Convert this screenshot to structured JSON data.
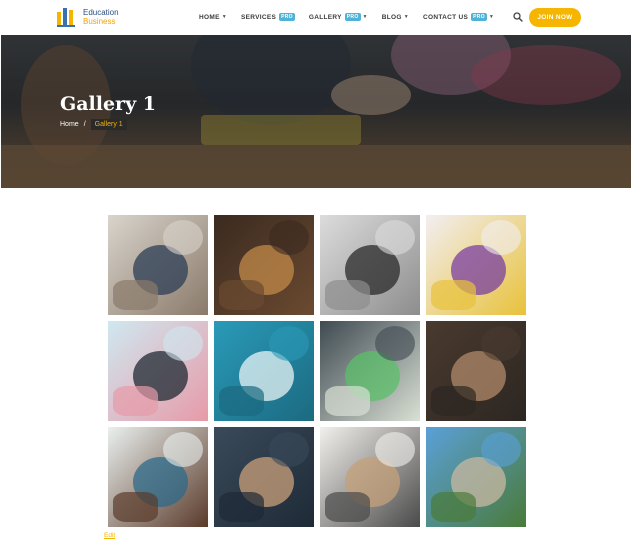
{
  "header": {
    "logo_line1": "Education",
    "logo_line2": "Business",
    "nav": [
      {
        "label": "HOME",
        "pro": false,
        "caret": true
      },
      {
        "label": "SERVICES",
        "pro": true,
        "caret": false
      },
      {
        "label": "GALLERY",
        "pro": true,
        "caret": true
      },
      {
        "label": "BLOG",
        "pro": false,
        "caret": true
      },
      {
        "label": "CONTACT US",
        "pro": true,
        "caret": true
      }
    ],
    "pro_badge": "PRO",
    "join_label": "JOIN NOW"
  },
  "hero": {
    "title": "Gallery 1",
    "breadcrumb_home": "Home",
    "breadcrumb_sep": "/",
    "breadcrumb_current": "Gallery 1"
  },
  "gallery": {
    "tiles": [
      {
        "subject": "students-writing",
        "colors": [
          "#d9d4cc",
          "#2c3e55",
          "#8a7a6a"
        ]
      },
      {
        "subject": "library-hall",
        "colors": [
          "#3a2a20",
          "#c28a4a",
          "#6b4a30"
        ]
      },
      {
        "subject": "classroom-screen",
        "colors": [
          "#dcdcdc",
          "#2a2a2a",
          "#8d8d8d"
        ]
      },
      {
        "subject": "colored-pencils",
        "colors": [
          "#f2eef2",
          "#7b3fa0",
          "#e8c23a"
        ]
      },
      {
        "subject": "pencil-cup",
        "colors": [
          "#cfe8f0",
          "#1f2a33",
          "#e79aa8"
        ]
      },
      {
        "subject": "palm-leaf",
        "colors": [
          "#2a9ab8",
          "#e8f4f6",
          "#1b6a80"
        ]
      },
      {
        "subject": "paint-palette",
        "colors": [
          "#3f4a52",
          "#5bbf6a",
          "#d9e0d4"
        ]
      },
      {
        "subject": "student-glasses",
        "colors": [
          "#4a3a2e",
          "#b08a6a",
          "#2c2622"
        ]
      },
      {
        "subject": "girl-studying",
        "colors": [
          "#eaf0ee",
          "#2e6a8a",
          "#5a3a2a"
        ]
      },
      {
        "subject": "woman-laptop",
        "colors": [
          "#3a4a5a",
          "#c9a07a",
          "#1e2a36"
        ]
      },
      {
        "subject": "group-table",
        "colors": [
          "#f2f0ec",
          "#c4a07a",
          "#4a4a4a"
        ]
      },
      {
        "subject": "university-building",
        "colors": [
          "#5aa0d8",
          "#c8b8a0",
          "#4a7a3a"
        ]
      }
    ]
  },
  "footer": {
    "edit_label": "Edit"
  }
}
